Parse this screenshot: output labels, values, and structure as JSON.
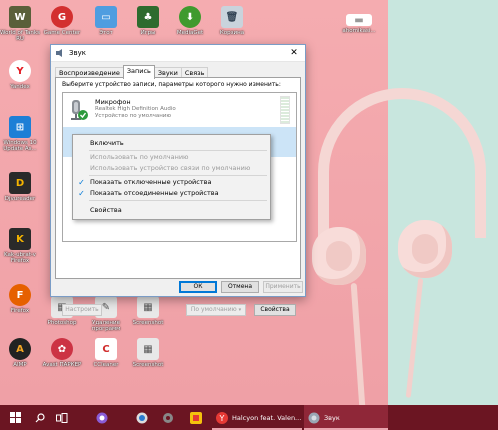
{
  "desktop": {
    "icons": [
      {
        "label": "World of Tanks RU",
        "color": "#5a5f3a",
        "glyph": "W"
      },
      {
        "label": "Game Center",
        "color": "#d32f2f",
        "glyph": "G"
      },
      {
        "label": "Этот",
        "color": "#4f9de0",
        "glyph": "▭"
      },
      {
        "label": "Игры",
        "color": "#2e6b2e",
        "glyph": "♣"
      },
      {
        "label": "MediaGet",
        "color": "#3f9a2e",
        "glyph": "⬇"
      },
      {
        "label": "Корзина",
        "color": "#c9d3dc",
        "glyph": "🗑"
      },
      {
        "label": "Yandex",
        "color": "#ffffff",
        "glyph": "Y"
      },
      {
        "label": "Windows 10 Update As...",
        "color": "#1d7fd6",
        "glyph": "⊞"
      },
      {
        "label": "Djvureader",
        "color": "#2a2a2a",
        "glyph": "D"
      },
      {
        "label": "Kak-ubrat-v Firefox",
        "color": "#2a2a2a",
        "glyph": "K"
      },
      {
        "label": "Firefox",
        "color": "#e66000",
        "glyph": "F"
      },
      {
        "label": "Photoshop",
        "color": "#e8e8e8",
        "glyph": "▦"
      },
      {
        "label": "Удаление программ",
        "color": "#e8e8e8",
        "glyph": "✎"
      },
      {
        "label": "Screenshot",
        "color": "#e8e8e8",
        "glyph": "▦"
      },
      {
        "label": "AIMP",
        "color": "#f5a623",
        "glyph": "A"
      },
      {
        "label": "Avast ПАРКЕР",
        "color": "#cc3344",
        "glyph": "✿"
      },
      {
        "label": "CCleaner",
        "color": "#d02b2b",
        "glyph": "C"
      },
      {
        "label": "Screenshot",
        "color": "#e8e8e8",
        "glyph": "▦"
      },
      {
        "label": "ahomikasi...",
        "color": "#ffffff",
        "glyph": "▬"
      }
    ]
  },
  "dialog": {
    "title": "Звук",
    "close_glyph": "✕",
    "tabs": [
      {
        "label": "Воспроизведение"
      },
      {
        "label": "Запись"
      },
      {
        "label": "Звуки"
      },
      {
        "label": "Связь"
      }
    ],
    "hint": "Выберите устройство записи, параметры которого нужно изменить:",
    "devices": [
      {
        "name": "Микрофон",
        "desc": "Realtek High Definition Audio",
        "status": "Устройство по умолчанию"
      }
    ],
    "buttons": {
      "configure": "Настроить",
      "default": "По умолчанию",
      "properties": "Свойства",
      "ok": "ОК",
      "cancel": "Отмена",
      "apply": "Применить"
    }
  },
  "context_menu": {
    "items": [
      {
        "label": "Включить",
        "enabled": true,
        "checked": false
      },
      {
        "label": "Использовать по умолчанию",
        "enabled": false,
        "checked": false
      },
      {
        "label": "Использовать устройство связи по умолчанию",
        "enabled": false,
        "checked": false
      },
      {
        "label": "Показать отключенные устройства",
        "enabled": true,
        "checked": true
      },
      {
        "label": "Показать отсоединенные устройства",
        "enabled": true,
        "checked": true
      },
      {
        "label": "Свойства",
        "enabled": true,
        "checked": false
      }
    ],
    "check_glyph": "✓"
  },
  "taskbar": {
    "apps": [
      {
        "label": "Halcyon feat. Valen..."
      },
      {
        "label": "Звук"
      }
    ]
  }
}
